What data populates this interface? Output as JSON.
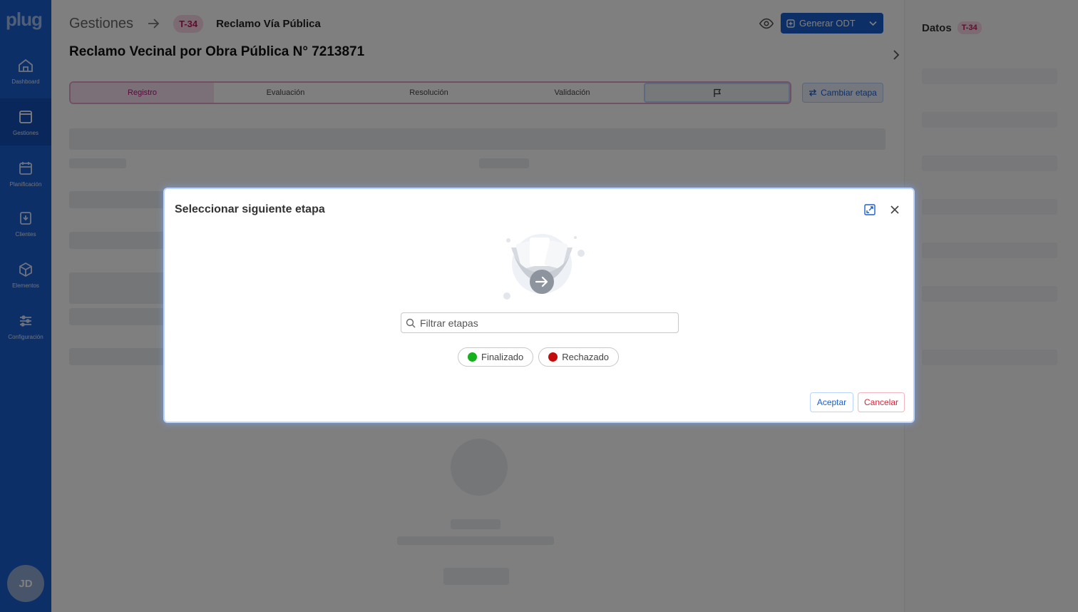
{
  "app": {
    "logo": "plug"
  },
  "sidebar": {
    "items": [
      {
        "label": "Dashboard",
        "icon": "home-icon"
      },
      {
        "label": "Gestiones",
        "icon": "folder-icon"
      },
      {
        "label": "Planificación",
        "icon": "calendar-icon"
      },
      {
        "label": "Clientes",
        "icon": "clients-icon"
      },
      {
        "label": "Elementos",
        "icon": "cube-icon"
      },
      {
        "label": "Configuración",
        "icon": "settings-icon"
      }
    ],
    "avatar": "JD"
  },
  "header": {
    "breadcrumb_root": "Gestiones",
    "ticket_badge": "T-34",
    "category": "Reclamo Vía Pública",
    "generate_button": "Generar ODT",
    "title": "Reclamo Vecinal por Obra Pública N° 7213871"
  },
  "stages": {
    "items": [
      "Registro",
      "Evaluación",
      "Resolución",
      "Validación"
    ],
    "change_button": "Cambiar etapa"
  },
  "right_panel": {
    "heading": "Datos",
    "badge": "T-34"
  },
  "modal": {
    "title": "Seleccionar siguiente etapa",
    "search_placeholder": "Filtrar etapas",
    "options": [
      {
        "label": "Finalizado",
        "color": "#16b01d"
      },
      {
        "label": "Rechazado",
        "color": "#c30d0d"
      }
    ],
    "accept_button": "Aceptar",
    "cancel_button": "Cancelar"
  },
  "colors": {
    "primary": "#1a5fd0",
    "accent_pink": "#b0127a",
    "danger": "#d8253b"
  }
}
